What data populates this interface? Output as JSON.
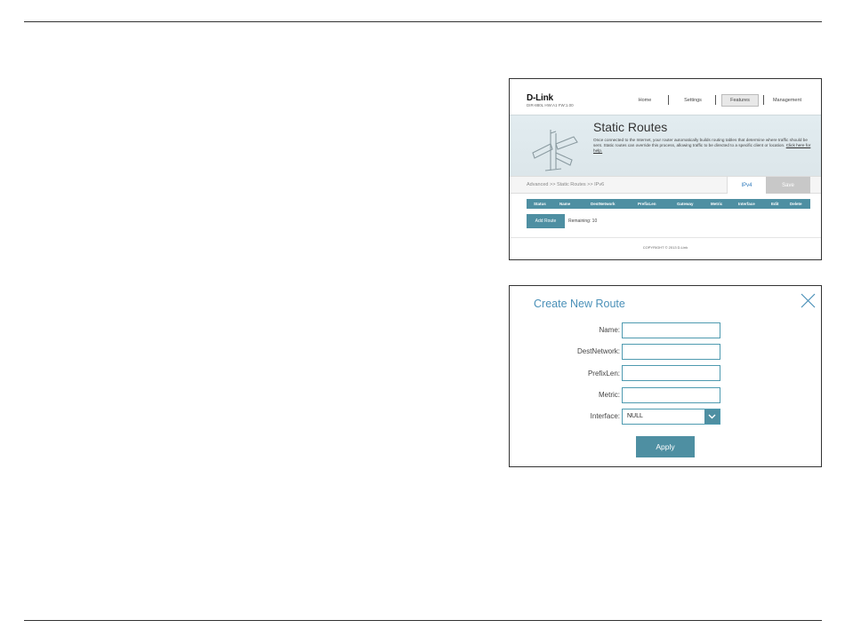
{
  "static_routes_page": {
    "logo": "D-Link",
    "model_line": "DIR-880L   HW:A1   FW:1.00",
    "nav": {
      "home": "Home",
      "settings": "Settings",
      "features": "Features",
      "management": "Management"
    },
    "title": "Static Routes",
    "description": "Once connected to the Internet, your router automatically builds routing tables that determine where traffic should be sent. Static routes can override this process, allowing traffic to be directed to a specific client or location.",
    "help_link": "Click here for help.",
    "breadcrumb": "Advanced >> Static Routes >> IPv6",
    "ipv4_tab": "IPv4",
    "save_label": "Save",
    "table_headers": [
      "Status",
      "Name",
      "DestNetwork",
      "PrefixLen",
      "Gateway",
      "Metric",
      "Interface",
      "Edit",
      "Delete"
    ],
    "add_route_label": "Add Route",
    "remaining": "Remaining: 10",
    "copyright": "COPYRIGHT © 2013 D-Link"
  },
  "create_route_dialog": {
    "title": "Create New Route",
    "labels": {
      "name": "Name:",
      "dest_network": "DestNetwork:",
      "prefix_len": "PrefixLen:",
      "metric": "Metric:",
      "interface": "Interface:"
    },
    "values": {
      "name": "",
      "dest_network": "",
      "prefix_len": "",
      "metric": ""
    },
    "interface_selected": "NULL",
    "apply_label": "Apply"
  },
  "colors": {
    "accent_teal": "#4e8fa2",
    "title_blue": "#4a90b8",
    "banner_bg": "#e2ecf0"
  },
  "icons": [
    "signpost-icon",
    "close-icon",
    "chevron-down-icon"
  ]
}
